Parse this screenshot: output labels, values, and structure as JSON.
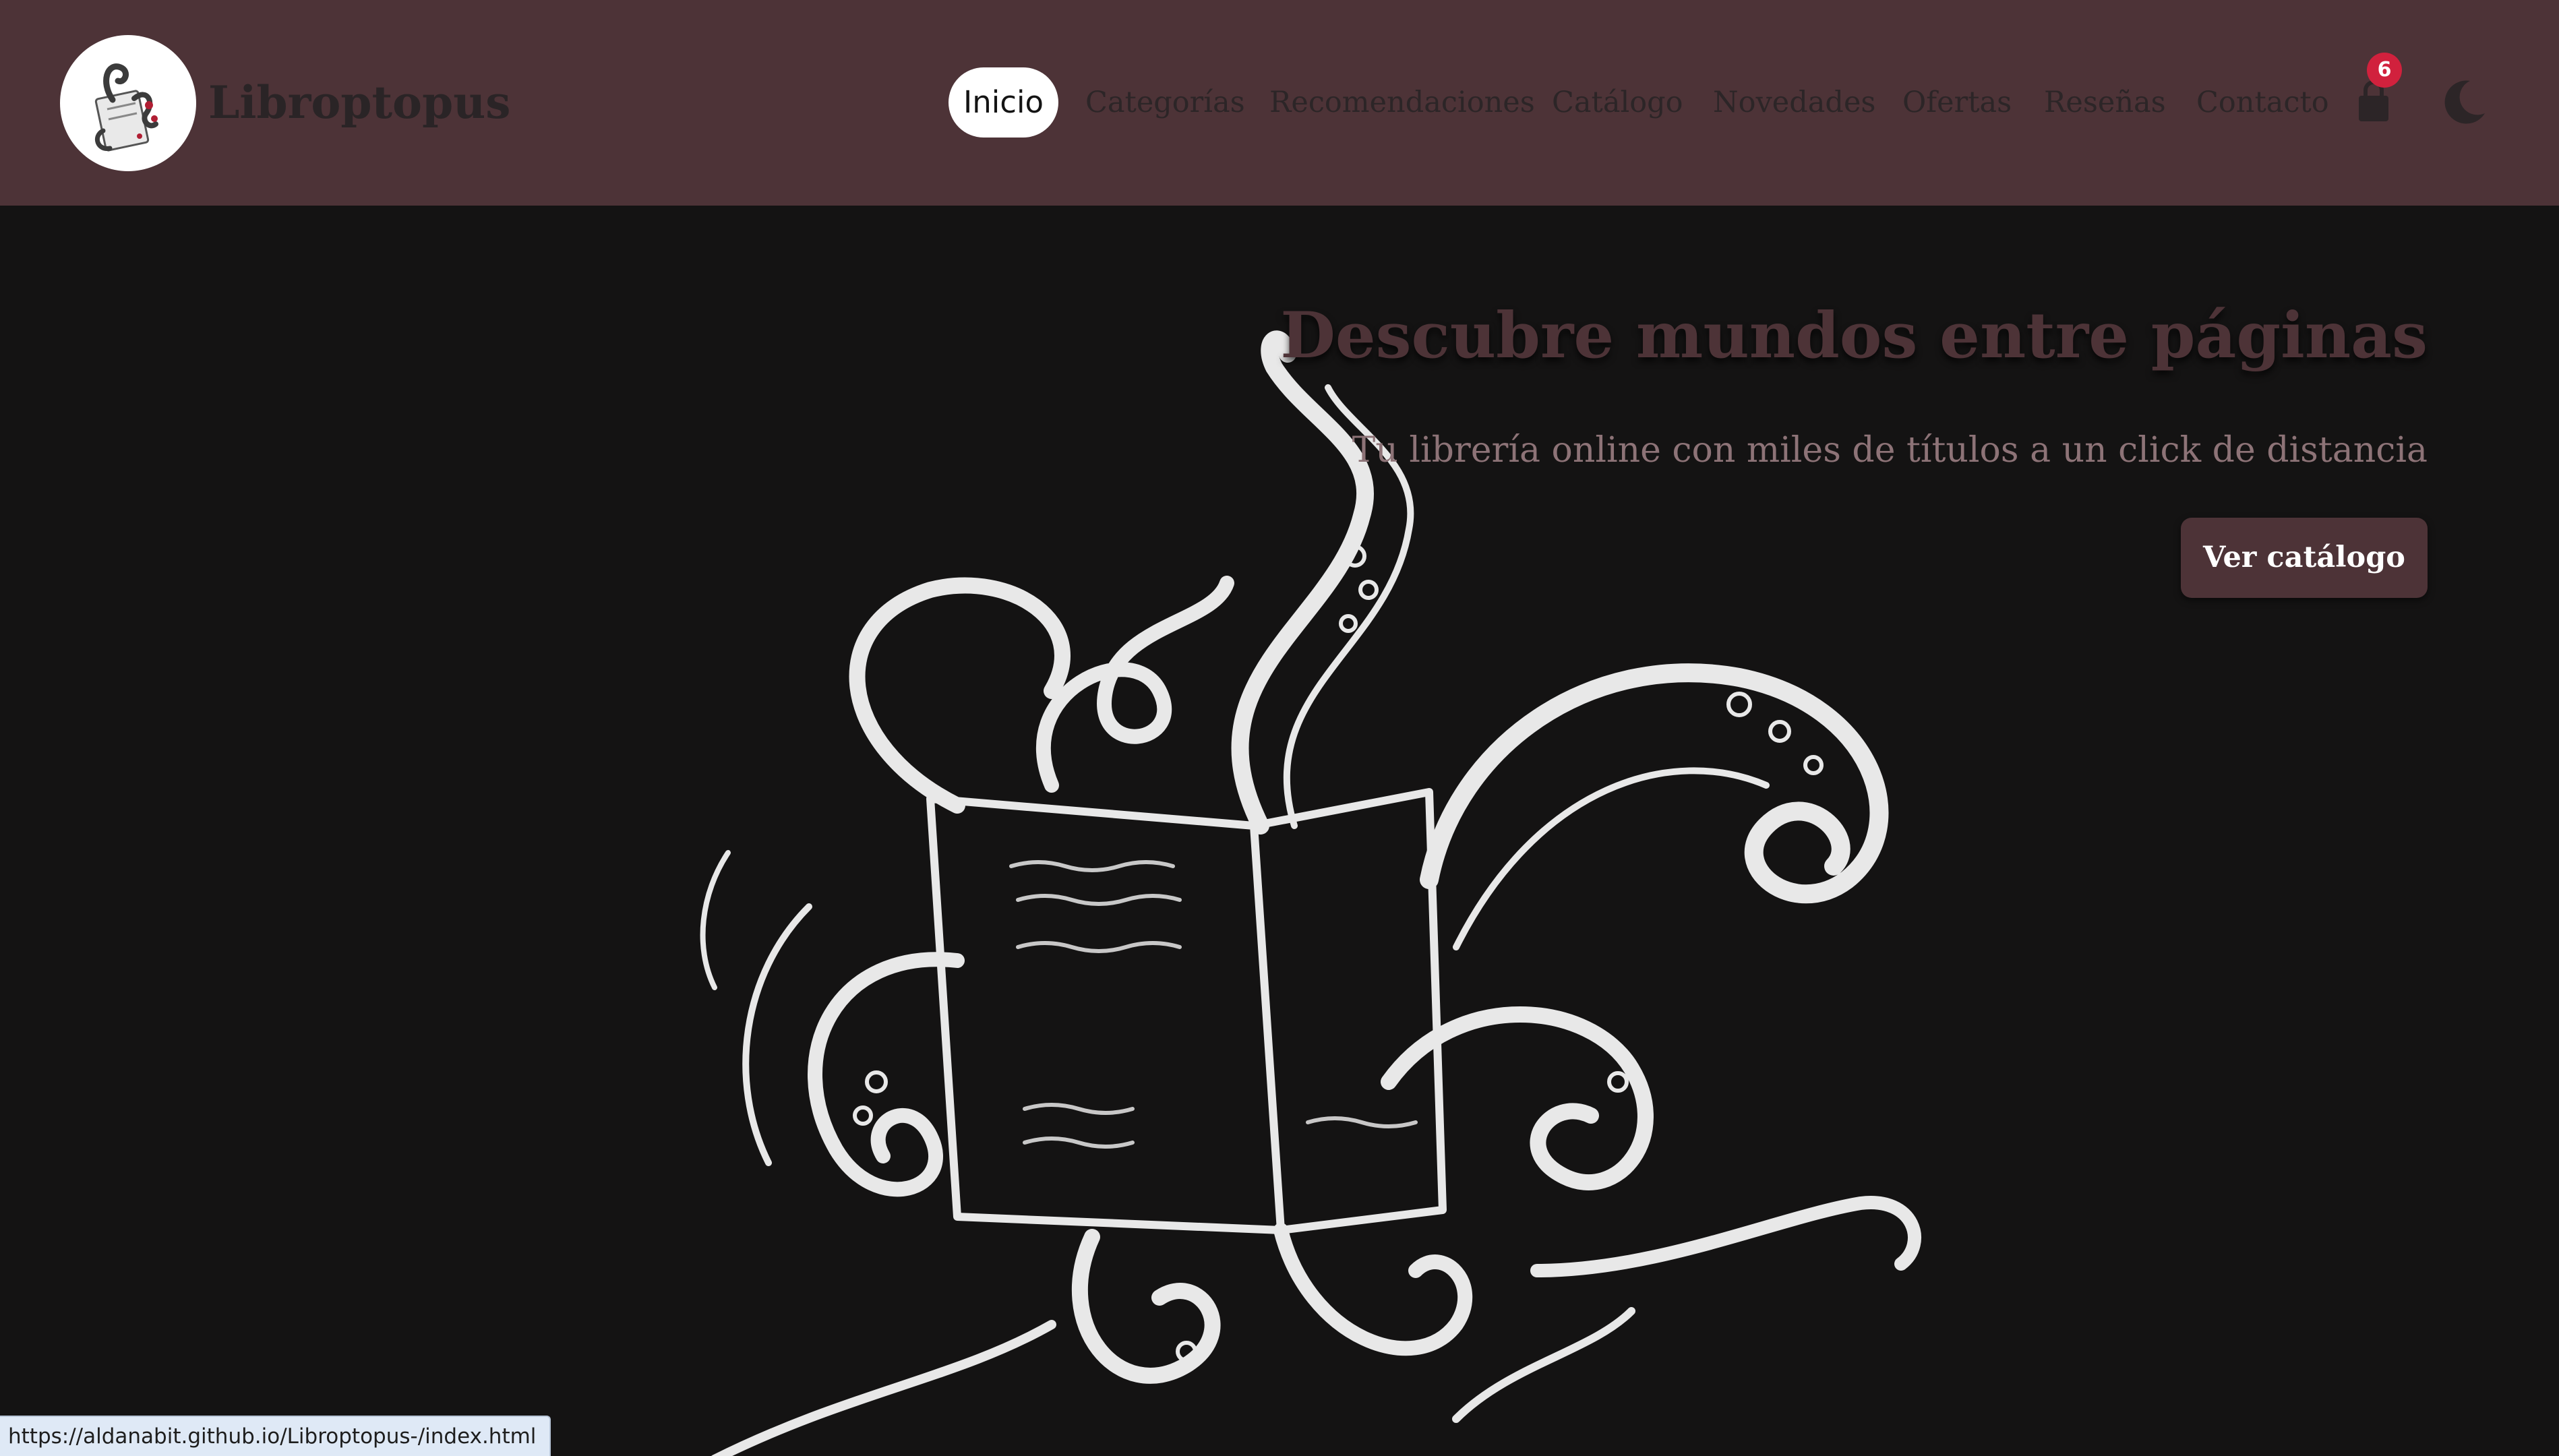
{
  "brand": {
    "name": "Libroptopus",
    "logo_icon": "octopus-book-logo-icon"
  },
  "nav": {
    "items": [
      {
        "label": "Inicio",
        "active": true
      },
      {
        "label": "Categorías",
        "active": false
      },
      {
        "label": "Recomendaciones",
        "active": false
      },
      {
        "label": "Catálogo",
        "active": false
      },
      {
        "label": "Novedades",
        "active": false
      },
      {
        "label": "Ofertas",
        "active": false
      },
      {
        "label": "Reseñas",
        "active": false
      },
      {
        "label": "Contacto",
        "active": false
      }
    ],
    "cart": {
      "icon": "shopping-bag-icon",
      "count": "6"
    },
    "theme_toggle": {
      "icon": "moon-icon"
    }
  },
  "hero": {
    "title": "Descubre mundos entre páginas",
    "subtitle": "Tu librería online con miles de títulos a un click de distancia",
    "button_label": "Ver catálogo",
    "image_icon": "octopus-tentacles-book-illustration"
  },
  "status_bar": {
    "url": "https://aldanabit.github.io/Libroptopus-/index.html"
  },
  "colors": {
    "navbar_bg": "#4d3337",
    "hero_bg": "#141313",
    "accent": "#4d3337",
    "badge": "#d1213d",
    "subtitle": "#8d7377"
  }
}
